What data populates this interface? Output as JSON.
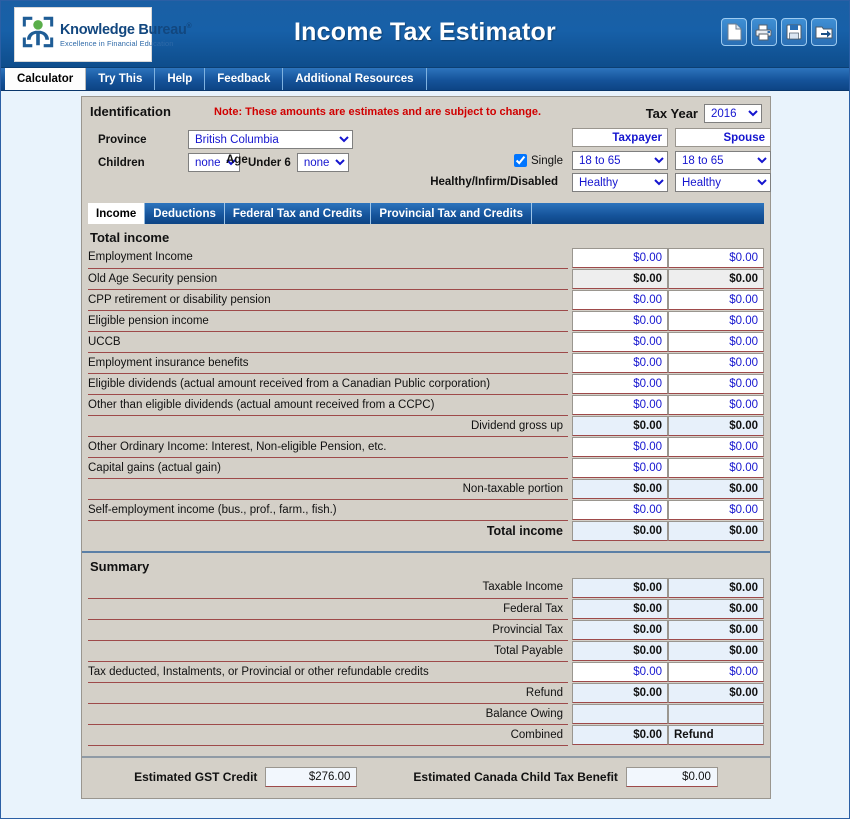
{
  "app": {
    "title": "Income Tax Estimator",
    "logo": {
      "name": "Knowledge Bureau",
      "registered": "®",
      "tagline": "Excellence in Financial Education"
    },
    "header_icons": [
      {
        "name": "new-document-icon",
        "label": "New"
      },
      {
        "name": "print-icon",
        "label": "Print"
      },
      {
        "name": "save-icon",
        "label": "Save"
      },
      {
        "name": "open-file-icon",
        "label": "Open"
      }
    ]
  },
  "main_tabs": [
    {
      "label": "Calculator",
      "active": true
    },
    {
      "label": "Try This",
      "active": false
    },
    {
      "label": "Help",
      "active": false
    },
    {
      "label": "Feedback",
      "active": false
    },
    {
      "label": "Additional Resources",
      "active": false
    }
  ],
  "identification": {
    "heading": "Identification",
    "note_prefix": "Note:",
    "note_text": " These amounts are estimates and are subject to change.",
    "tax_year_label": "Tax Year",
    "tax_year_value": "2016",
    "province_label": "Province",
    "province_value": "British Columbia",
    "children_label": "Children",
    "children_value": "none",
    "under6_label": "Under 6",
    "under6_value": "none",
    "single_label": "Single",
    "single_checked": true,
    "age_label": "Age",
    "health_label": "Healthy/Infirm/Disabled",
    "taxpayer_header": "Taxpayer",
    "spouse_header": "Spouse",
    "age_taxpayer": "18 to 65",
    "age_spouse": "18 to 65",
    "health_taxpayer": "Healthy",
    "health_spouse": "Healthy"
  },
  "sub_tabs": [
    {
      "label": "Income",
      "active": true
    },
    {
      "label": "Deductions",
      "active": false
    },
    {
      "label": "Federal Tax and Credits",
      "active": false
    },
    {
      "label": "Provincial Tax and Credits",
      "active": false
    }
  ],
  "income": {
    "section_title": "Total income",
    "rows": [
      {
        "label": "Employment Income",
        "align": "left",
        "taxpayer": "$0.00",
        "spouse": "$0.00",
        "readonly": false,
        "style": "normal"
      },
      {
        "label": "Old Age Security pension",
        "align": "left",
        "taxpayer": "$0.00",
        "spouse": "$0.00",
        "readonly": true,
        "style": "gray"
      },
      {
        "label": "CPP retirement or disability pension",
        "align": "left",
        "taxpayer": "$0.00",
        "spouse": "$0.00",
        "readonly": false,
        "style": "normal"
      },
      {
        "label": "Eligible pension income",
        "align": "left",
        "taxpayer": "$0.00",
        "spouse": "$0.00",
        "readonly": false,
        "style": "normal"
      },
      {
        "label": "UCCB",
        "align": "left",
        "taxpayer": "$0.00",
        "spouse": "$0.00",
        "readonly": false,
        "style": "normal"
      },
      {
        "label": "Employment insurance benefits",
        "align": "left",
        "taxpayer": "$0.00",
        "spouse": "$0.00",
        "readonly": false,
        "style": "normal"
      },
      {
        "label": "Eligible dividends (actual amount received from a Canadian Public corporation)",
        "align": "left",
        "taxpayer": "$0.00",
        "spouse": "$0.00",
        "readonly": false,
        "style": "normal"
      },
      {
        "label": "Other than eligible dividends (actual amount received from a CCPC)",
        "align": "left",
        "taxpayer": "$0.00",
        "spouse": "$0.00",
        "readonly": false,
        "style": "normal"
      },
      {
        "label": "Dividend gross up",
        "align": "right",
        "taxpayer": "$0.00",
        "spouse": "$0.00",
        "readonly": true,
        "style": "blueish"
      },
      {
        "label": "Other Ordinary Income: Interest, Non-eligible Pension, etc.",
        "align": "left",
        "taxpayer": "$0.00",
        "spouse": "$0.00",
        "readonly": false,
        "style": "normal"
      },
      {
        "label": "Capital gains (actual gain)",
        "align": "left",
        "taxpayer": "$0.00",
        "spouse": "$0.00",
        "readonly": false,
        "style": "normal"
      },
      {
        "label": "Non-taxable portion",
        "align": "right",
        "taxpayer": "$0.00",
        "spouse": "$0.00",
        "readonly": true,
        "style": "blueish"
      },
      {
        "label": "Self-employment income (bus., prof., farm., fish.)",
        "align": "left",
        "taxpayer": "$0.00",
        "spouse": "$0.00",
        "readonly": false,
        "style": "normal"
      },
      {
        "label": "Total income",
        "align": "right",
        "taxpayer": "$0.00",
        "spouse": "$0.00",
        "readonly": true,
        "style": "total"
      }
    ]
  },
  "summary": {
    "section_title": "Summary",
    "rows": [
      {
        "label": "Taxable Income",
        "align": "right",
        "taxpayer": "$0.00",
        "spouse": "$0.00",
        "readonly": true,
        "style": "blueish"
      },
      {
        "label": "Federal Tax",
        "align": "right",
        "taxpayer": "$0.00",
        "spouse": "$0.00",
        "readonly": true,
        "style": "blueish"
      },
      {
        "label": "Provincial Tax",
        "align": "right",
        "taxpayer": "$0.00",
        "spouse": "$0.00",
        "readonly": true,
        "style": "blueish"
      },
      {
        "label": "Total Payable",
        "align": "right",
        "taxpayer": "$0.00",
        "spouse": "$0.00",
        "readonly": true,
        "style": "blueish"
      },
      {
        "label": "Tax deducted, Instalments, or Provincial or other refundable credits",
        "align": "left",
        "taxpayer": "$0.00",
        "spouse": "$0.00",
        "readonly": false,
        "style": "normal"
      },
      {
        "label": "Refund",
        "align": "right",
        "taxpayer": "$0.00",
        "spouse": "$0.00",
        "readonly": true,
        "style": "blueish"
      },
      {
        "label": "Balance Owing",
        "align": "right",
        "taxpayer": "",
        "spouse": "",
        "readonly": true,
        "style": "blueish"
      },
      {
        "label": "Combined",
        "align": "right",
        "taxpayer": "$0.00",
        "spouse": "Refund",
        "readonly": true,
        "style": "combined"
      }
    ]
  },
  "credits": {
    "gst_label": "Estimated GST Credit",
    "gst_value": "$276.00",
    "cctb_label": "Estimated Canada Child Tax Benefit",
    "cctb_value": "$0.00"
  },
  "colors": {
    "header_blue": "#15539a",
    "panel_gray": "#d4d0c8",
    "field_blue_text": "#1515cf",
    "note_red": "#d00000",
    "underline_red": "#9e4a4a",
    "page_background": "#e9f3fc"
  }
}
